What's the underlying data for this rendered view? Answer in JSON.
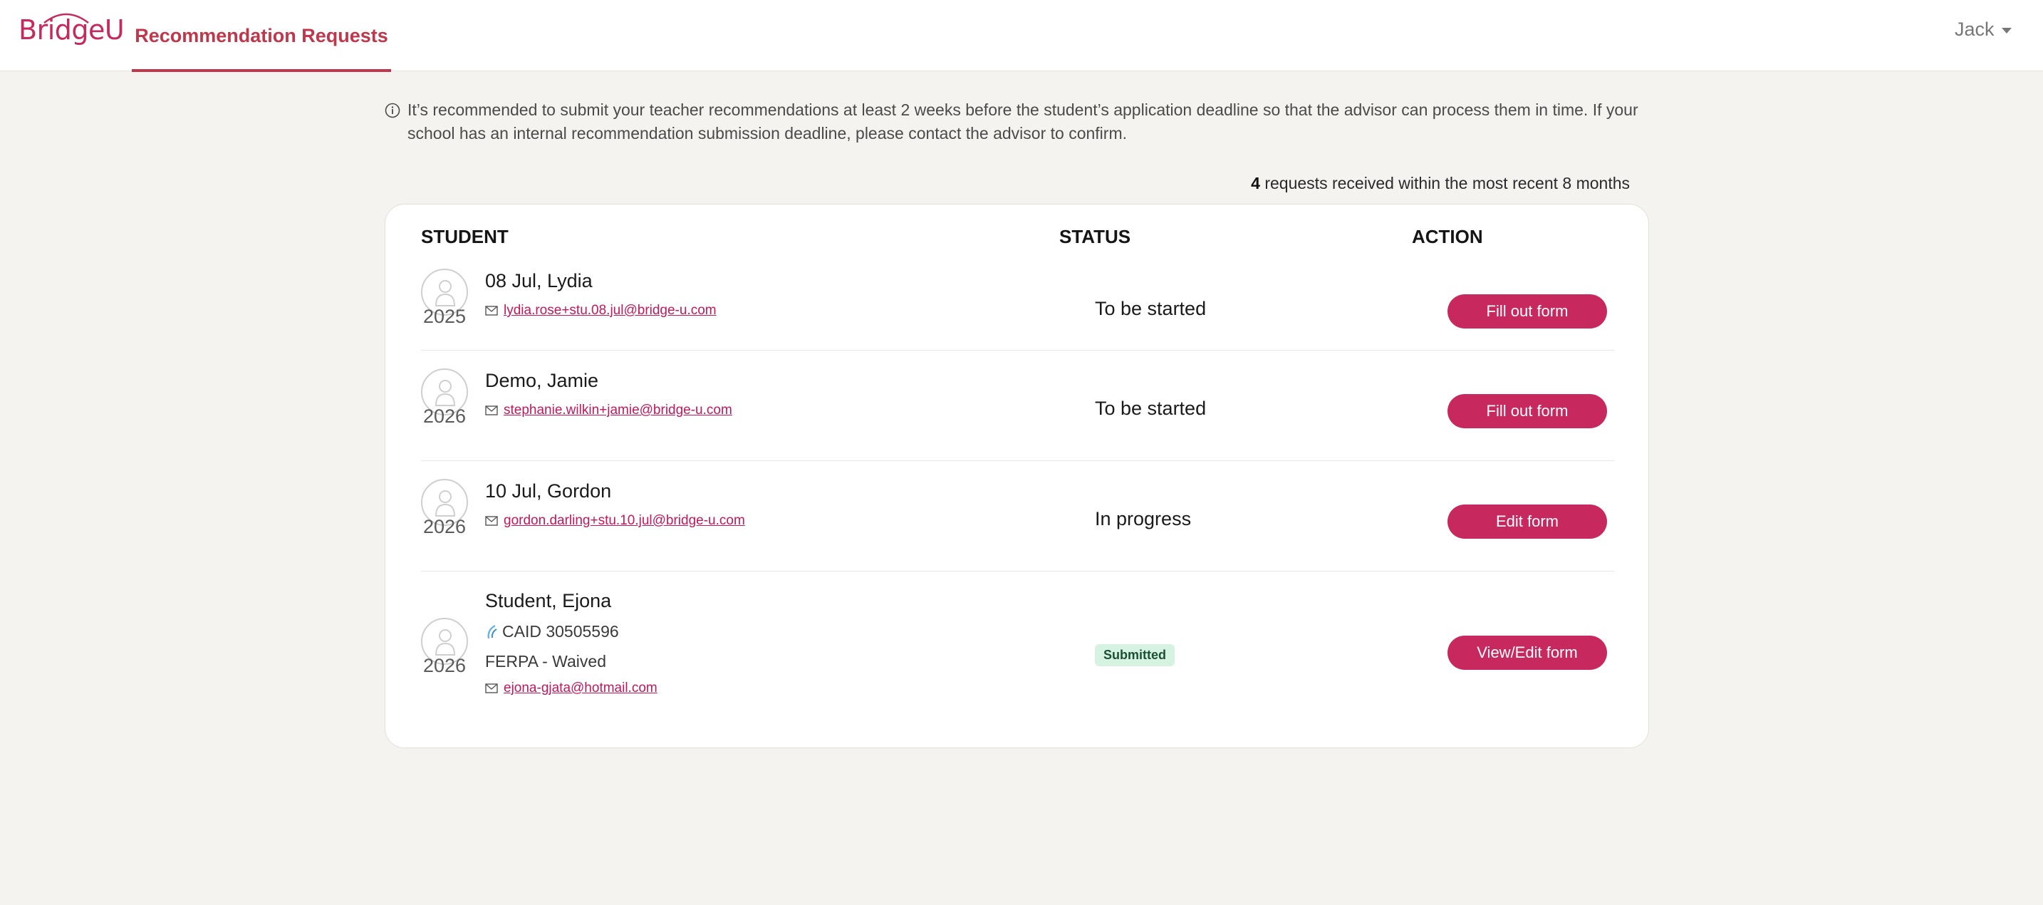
{
  "header": {
    "logo": "BridgeU",
    "nav_tab": "Recommendation Requests",
    "user": "Jack"
  },
  "notice": {
    "icon": "info-icon",
    "text": "It’s recommended to submit your teacher recommendations at least 2 weeks before the student’s application deadline so that the advisor can process them in time. If your school has an internal recommendation submission deadline, please contact the advisor to confirm."
  },
  "summary": {
    "count": "4",
    "text": " requests received within the most recent 8 months"
  },
  "table": {
    "headers": {
      "student": "STUDENT",
      "status": "STATUS",
      "action": "ACTION"
    },
    "rows": [
      {
        "year": "2025",
        "name": "08 Jul, Lydia",
        "email": "lydia.rose+stu.08.jul@bridge-u.com",
        "status": "To be started",
        "action": "Fill out form"
      },
      {
        "year": "2026",
        "name": "Demo, Jamie",
        "email": "stephanie.wilkin+jamie@bridge-u.com",
        "status": "To be started",
        "action": "Fill out form"
      },
      {
        "year": "2026",
        "name": "10 Jul, Gordon",
        "email": "gordon.darling+stu.10.jul@bridge-u.com",
        "status": "In progress",
        "action": "Edit form"
      },
      {
        "year": "2026",
        "name": "Student, Ejona",
        "caid": "CAID 30505596",
        "ferpa": "FERPA - Waived",
        "email": "ejona-gjata@hotmail.com",
        "status": "Submitted",
        "action": "View/Edit form"
      }
    ]
  },
  "colors": {
    "brand": "#c7285d",
    "tab_active": "#c0364a",
    "badge_bg": "#d6f3e1",
    "page_bg": "#f5f3f0"
  }
}
